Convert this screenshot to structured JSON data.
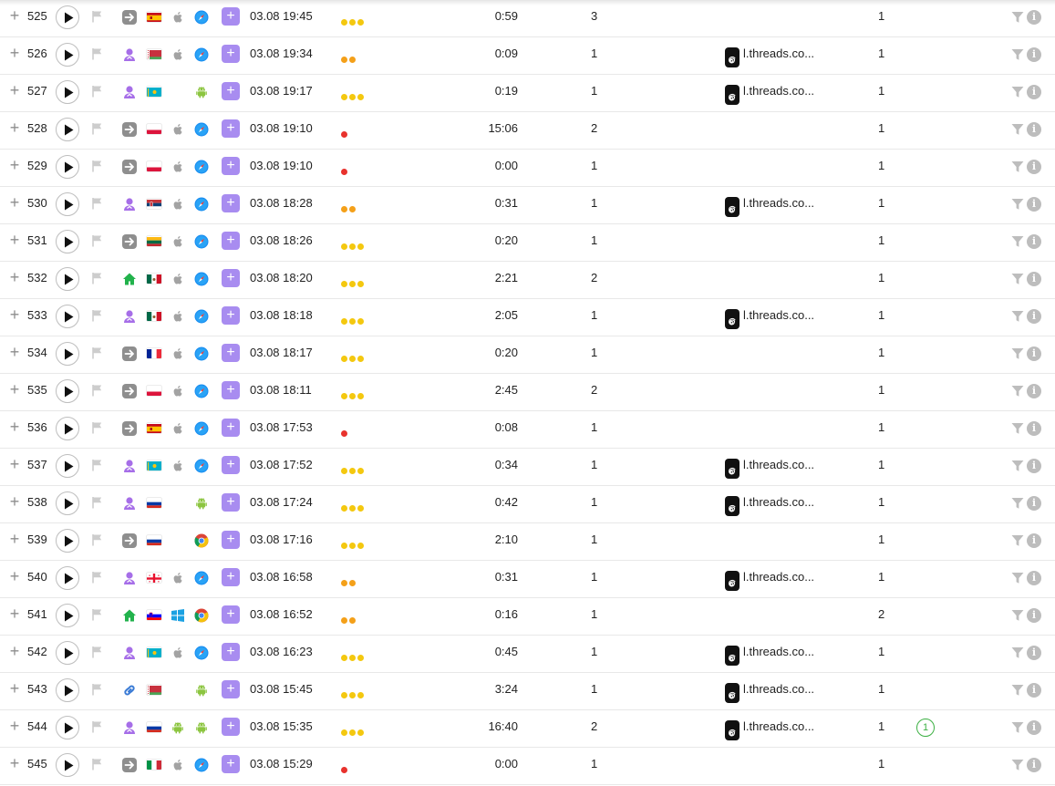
{
  "colors": {
    "dot_yellow": "#f4c80f",
    "dot_orange": "#f4a019",
    "dot_red": "#e8322d",
    "add_button": "#a88cf0",
    "badge_green": "#3cb043"
  },
  "add_label": "+",
  "info_label": "i",
  "rows": [
    {
      "id": "525",
      "source": "direct-icon",
      "country": "es",
      "os": "apple-icon",
      "browser": "safari-icon",
      "datetime": "03.08 19:45",
      "engagement": "yellow",
      "dots": 3,
      "duration": "0:59",
      "pages": "3",
      "referrer": "",
      "count": "1",
      "badge": ""
    },
    {
      "id": "526",
      "source": "social-icon",
      "country": "by",
      "os": "apple-icon",
      "browser": "safari-icon",
      "datetime": "03.08 19:34",
      "engagement": "orange",
      "dots": 2,
      "duration": "0:09",
      "pages": "1",
      "referrer": "l.threads.co...",
      "count": "1",
      "badge": ""
    },
    {
      "id": "527",
      "source": "social-icon",
      "country": "kz",
      "os": "",
      "browser": "android-icon",
      "datetime": "03.08 19:17",
      "engagement": "yellow",
      "dots": 3,
      "duration": "0:19",
      "pages": "1",
      "referrer": "l.threads.co...",
      "count": "1",
      "badge": ""
    },
    {
      "id": "528",
      "source": "direct-icon",
      "country": "pl",
      "os": "apple-icon",
      "browser": "safari-icon",
      "datetime": "03.08 19:10",
      "engagement": "red",
      "dots": 1,
      "duration": "15:06",
      "pages": "2",
      "referrer": "",
      "count": "1",
      "badge": ""
    },
    {
      "id": "529",
      "source": "direct-icon",
      "country": "pl",
      "os": "apple-icon",
      "browser": "safari-icon",
      "datetime": "03.08 19:10",
      "engagement": "red",
      "dots": 1,
      "duration": "0:00",
      "pages": "1",
      "referrer": "",
      "count": "1",
      "badge": ""
    },
    {
      "id": "530",
      "source": "social-icon",
      "country": "rs",
      "os": "apple-icon",
      "browser": "safari-icon",
      "datetime": "03.08 18:28",
      "engagement": "orange",
      "dots": 2,
      "duration": "0:31",
      "pages": "1",
      "referrer": "l.threads.co...",
      "count": "1",
      "badge": ""
    },
    {
      "id": "531",
      "source": "direct-icon",
      "country": "lt",
      "os": "apple-icon",
      "browser": "safari-icon",
      "datetime": "03.08 18:26",
      "engagement": "yellow",
      "dots": 3,
      "duration": "0:20",
      "pages": "1",
      "referrer": "",
      "count": "1",
      "badge": ""
    },
    {
      "id": "532",
      "source": "home-icon",
      "country": "mx",
      "os": "apple-icon",
      "browser": "safari-icon",
      "datetime": "03.08 18:20",
      "engagement": "yellow",
      "dots": 3,
      "duration": "2:21",
      "pages": "2",
      "referrer": "",
      "count": "1",
      "badge": ""
    },
    {
      "id": "533",
      "source": "social-icon",
      "country": "mx",
      "os": "apple-icon",
      "browser": "safari-icon",
      "datetime": "03.08 18:18",
      "engagement": "yellow",
      "dots": 3,
      "duration": "2:05",
      "pages": "1",
      "referrer": "l.threads.co...",
      "count": "1",
      "badge": ""
    },
    {
      "id": "534",
      "source": "direct-icon",
      "country": "fr",
      "os": "apple-icon",
      "browser": "safari-icon",
      "datetime": "03.08 18:17",
      "engagement": "yellow",
      "dots": 3,
      "duration": "0:20",
      "pages": "1",
      "referrer": "",
      "count": "1",
      "badge": ""
    },
    {
      "id": "535",
      "source": "direct-icon",
      "country": "pl",
      "os": "apple-icon",
      "browser": "safari-icon",
      "datetime": "03.08 18:11",
      "engagement": "yellow",
      "dots": 3,
      "duration": "2:45",
      "pages": "2",
      "referrer": "",
      "count": "1",
      "badge": ""
    },
    {
      "id": "536",
      "source": "direct-icon",
      "country": "es",
      "os": "apple-icon",
      "browser": "safari-icon",
      "datetime": "03.08 17:53",
      "engagement": "red",
      "dots": 1,
      "duration": "0:08",
      "pages": "1",
      "referrer": "",
      "count": "1",
      "badge": ""
    },
    {
      "id": "537",
      "source": "social-icon",
      "country": "kz",
      "os": "apple-icon",
      "browser": "safari-icon",
      "datetime": "03.08 17:52",
      "engagement": "yellow",
      "dots": 3,
      "duration": "0:34",
      "pages": "1",
      "referrer": "l.threads.co...",
      "count": "1",
      "badge": ""
    },
    {
      "id": "538",
      "source": "social-icon",
      "country": "ru",
      "os": "",
      "browser": "android-icon",
      "datetime": "03.08 17:24",
      "engagement": "yellow",
      "dots": 3,
      "duration": "0:42",
      "pages": "1",
      "referrer": "l.threads.co...",
      "count": "1",
      "badge": ""
    },
    {
      "id": "539",
      "source": "direct-icon",
      "country": "ru",
      "os": "",
      "browser": "chrome-icon",
      "datetime": "03.08 17:16",
      "engagement": "yellow",
      "dots": 3,
      "duration": "2:10",
      "pages": "1",
      "referrer": "",
      "count": "1",
      "badge": ""
    },
    {
      "id": "540",
      "source": "social-icon",
      "country": "ge",
      "os": "apple-icon",
      "browser": "safari-icon",
      "datetime": "03.08 16:58",
      "engagement": "orange",
      "dots": 2,
      "duration": "0:31",
      "pages": "1",
      "referrer": "l.threads.co...",
      "count": "1",
      "badge": ""
    },
    {
      "id": "541",
      "source": "home-icon",
      "country": "si",
      "os": "windows-icon",
      "browser": "chrome-icon",
      "datetime": "03.08 16:52",
      "engagement": "orange",
      "dots": 2,
      "duration": "0:16",
      "pages": "1",
      "referrer": "",
      "count": "2",
      "badge": ""
    },
    {
      "id": "542",
      "source": "social-icon",
      "country": "kz",
      "os": "apple-icon",
      "browser": "safari-icon",
      "datetime": "03.08 16:23",
      "engagement": "yellow",
      "dots": 3,
      "duration": "0:45",
      "pages": "1",
      "referrer": "l.threads.co...",
      "count": "1",
      "badge": ""
    },
    {
      "id": "543",
      "source": "link-icon",
      "country": "by",
      "os": "",
      "browser": "android-icon",
      "datetime": "03.08 15:45",
      "engagement": "yellow",
      "dots": 3,
      "duration": "3:24",
      "pages": "1",
      "referrer": "l.threads.co...",
      "count": "1",
      "badge": ""
    },
    {
      "id": "544",
      "source": "social-icon",
      "country": "ru",
      "os": "android-icon",
      "browser": "android-icon",
      "datetime": "03.08 15:35",
      "engagement": "yellow",
      "dots": 3,
      "duration": "16:40",
      "pages": "2",
      "referrer": "l.threads.co...",
      "count": "1",
      "badge": "1"
    },
    {
      "id": "545",
      "source": "direct-icon",
      "country": "it",
      "os": "apple-icon",
      "browser": "safari-icon",
      "datetime": "03.08 15:29",
      "engagement": "red",
      "dots": 1,
      "duration": "0:00",
      "pages": "1",
      "referrer": "",
      "count": "1",
      "badge": ""
    }
  ]
}
